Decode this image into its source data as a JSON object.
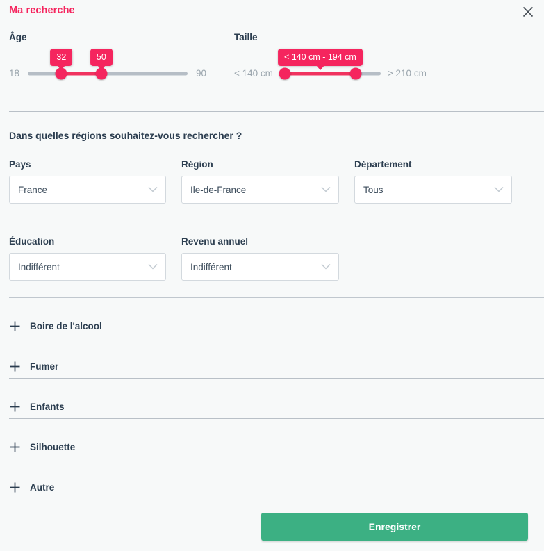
{
  "panel": {
    "title": "Ma recherche",
    "close_icon": "close-icon"
  },
  "sliders": [
    {
      "key": "age",
      "label": "Âge",
      "min_label": "18",
      "max_label": "90",
      "bubbles": [
        "32",
        "50"
      ],
      "values": [
        32,
        50
      ],
      "range": [
        18,
        90
      ]
    },
    {
      "key": "taille",
      "label": "Taille",
      "min_label": "< 140 cm",
      "max_label": "> 210 cm",
      "bubbles": [
        "< 140 cm - 194 cm"
      ],
      "values": [
        140,
        194
      ],
      "range": [
        140,
        210
      ]
    }
  ],
  "question": "Dans quelles régions souhaitez-vous rechercher ?",
  "selects": [
    {
      "label": "Pays",
      "value": "France",
      "icon": "chevron-down-icon"
    },
    {
      "label": "Région",
      "value": "Ile-de-France",
      "icon": "chevron-down-icon"
    },
    {
      "label": "Département",
      "value": "Tous",
      "icon": "chevron-down-icon"
    },
    {
      "label": "Éducation",
      "value": "Indifférent",
      "icon": "chevron-down-icon"
    },
    {
      "label": "Revenu annuel",
      "value": "Indifférent",
      "icon": "chevron-down-icon"
    }
  ],
  "accordion": [
    {
      "label": "Boire de l'alcool",
      "icon": "plus-icon"
    },
    {
      "label": "Fumer",
      "icon": "plus-icon"
    },
    {
      "label": "Enfants",
      "icon": "plus-icon"
    },
    {
      "label": "Silhouette",
      "icon": "plus-icon"
    },
    {
      "label": "Autre",
      "icon": "plus-icon"
    }
  ],
  "footer": {
    "submit_label": "Enregistrer"
  },
  "colors": {
    "accent_pink": "#f5255e",
    "submit_green": "#3cb083",
    "page_bg": "#f7f9f9",
    "text_dark": "#2c3e50",
    "muted": "#9aa5ad"
  }
}
